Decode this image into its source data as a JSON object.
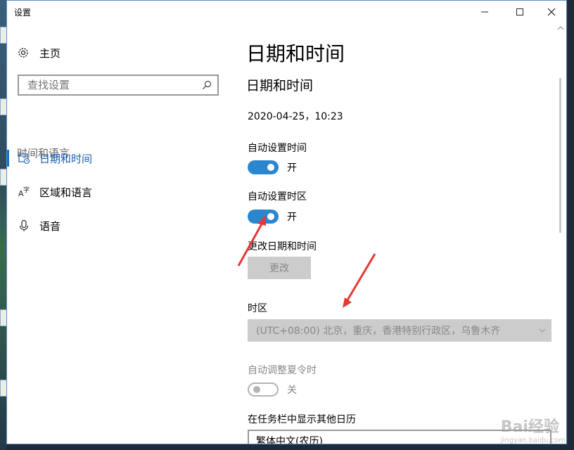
{
  "window": {
    "title": "设置",
    "minimize_label": "—",
    "maximize_label": "☐",
    "close_label": "✕"
  },
  "sidebar": {
    "home_label": "主页",
    "search_placeholder": "查找设置",
    "section_label": "时间和语言",
    "items": [
      {
        "label": "日期和时间",
        "icon": "calendar-clock-icon",
        "active": true
      },
      {
        "label": "区域和语言",
        "icon": "language-icon",
        "active": false
      },
      {
        "label": "语音",
        "icon": "microphone-icon",
        "active": false
      }
    ]
  },
  "content": {
    "page_title": "日期和时间",
    "sub_title": "日期和时间",
    "current_datetime": "2020-04-25，10:23",
    "auto_time": {
      "label": "自动设置时间",
      "state": "开",
      "on": true
    },
    "auto_timezone": {
      "label": "自动设置时区",
      "state": "开",
      "on": true
    },
    "change_datetime": {
      "label": "更改日期和时间",
      "button": "更改"
    },
    "timezone": {
      "label": "时区",
      "value": "(UTC+08:00) 北京，重庆，香港特别行政区，乌鲁木齐"
    },
    "dst": {
      "label": "自动调整夏令时",
      "state": "关",
      "on": false
    },
    "calendar": {
      "label": "在任务栏中显示其他日历",
      "value": "繁体中文(农历)"
    }
  },
  "colors": {
    "accent": "#2b86d0",
    "annotation_arrow": "#e53935"
  },
  "watermark": {
    "text": "Bai经验",
    "sub": "jingyan.baidu.com"
  }
}
